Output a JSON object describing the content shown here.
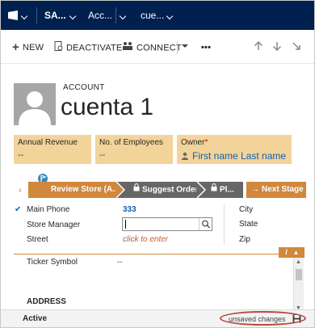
{
  "nav": {
    "org": "SA...",
    "area": "Acc...",
    "record": "cue..."
  },
  "commands": {
    "new": "NEW",
    "deactivate": "DEACTIVATE",
    "connect": "CONNECT",
    "more": "•••"
  },
  "header": {
    "entity_type": "ACCOUNT",
    "name": "cuenta 1",
    "fields": [
      {
        "label": "Annual Revenue",
        "value": "--"
      },
      {
        "label": "No. of Employees",
        "value": "--"
      },
      {
        "label": "Owner",
        "required": "*",
        "value": "First name Last name"
      }
    ]
  },
  "process": {
    "stages": [
      {
        "label": "Review Store (A..."
      },
      {
        "label": "Suggest Order"
      },
      {
        "label": "Pl..."
      }
    ],
    "next_stage": "Next Stage"
  },
  "form": {
    "main_phone_label": "Main Phone",
    "main_phone_value": "333",
    "store_manager_label": "Store Manager",
    "street_label": "Street",
    "street_value": "click to enter",
    "city_label": "City",
    "state_label": "State",
    "zip_label": "Zip",
    "ticker_label": "Ticker Symbol",
    "ticker_value": "--",
    "address_section": "ADDRESS"
  },
  "footer": {
    "status": "Active",
    "unsaved": "unsaved changes"
  },
  "colors": {
    "nav_bg": "#002050",
    "header_field_bg": "#f2d399",
    "accent_orange": "#d0883c",
    "link_blue": "#1160b7",
    "stage_gray": "#666666",
    "highlight_ring": "#b84a3a"
  }
}
